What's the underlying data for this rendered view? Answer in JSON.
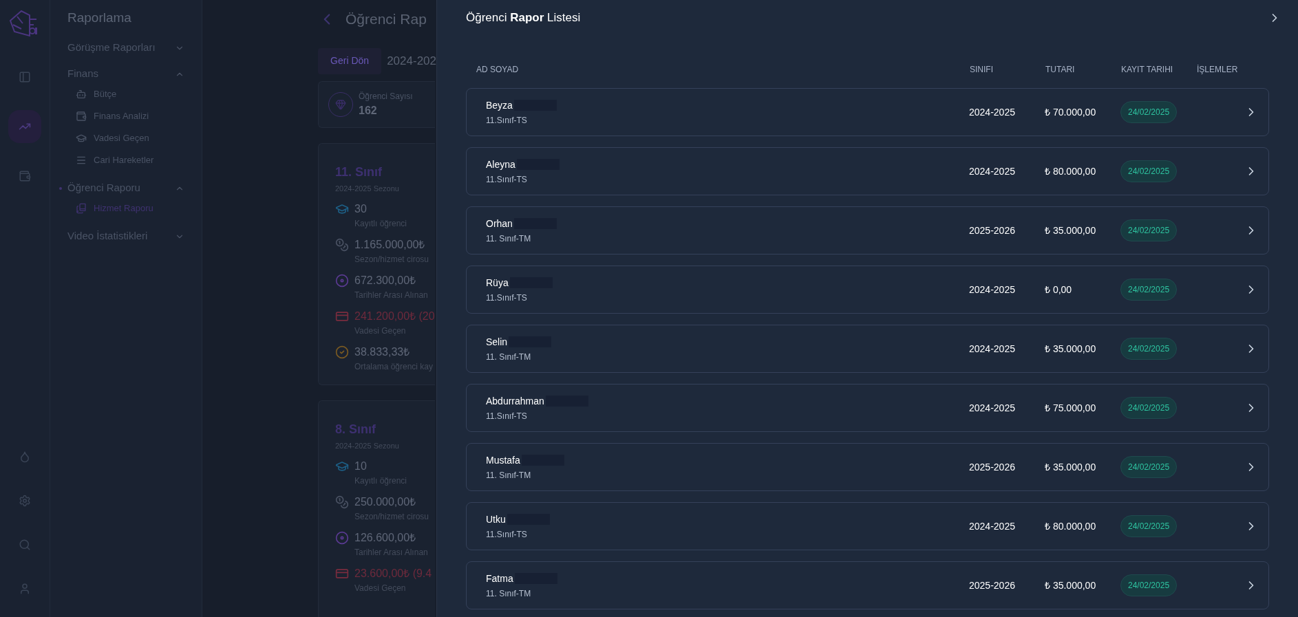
{
  "rail": {
    "items": [
      {
        "kind": "panel",
        "selected": false
      },
      {
        "kind": "chart",
        "selected": true
      },
      {
        "kind": "wallet",
        "selected": false
      }
    ],
    "bottom": [
      {
        "kind": "drop"
      },
      {
        "kind": "settings"
      },
      {
        "kind": "search"
      },
      {
        "kind": "user"
      }
    ]
  },
  "sidebar": {
    "title": "Raporlama",
    "groups": [
      {
        "label": "Görüşme Raporları",
        "expanded": false,
        "active": false
      },
      {
        "label": "Finans",
        "expanded": true,
        "active": false,
        "children": [
          {
            "label": "Bütçe",
            "kind": "bot",
            "selected": false
          },
          {
            "label": "Finans Analizi",
            "kind": "wallet",
            "selected": false
          },
          {
            "label": "Vadesi Geçen",
            "kind": "cap",
            "selected": false
          },
          {
            "label": "Cari Hareketler",
            "kind": "lines",
            "selected": false
          }
        ]
      },
      {
        "label": "Öğrenci Raporu",
        "expanded": true,
        "active": true,
        "children": [
          {
            "label": "Hizmet Raporu",
            "kind": "books",
            "selected": true
          }
        ]
      },
      {
        "label": "Video İstatistikleri",
        "expanded": false,
        "active": false
      }
    ]
  },
  "main": {
    "title": "Öğrenci Rap",
    "back_button": "Geri Dön",
    "season": "2024-202",
    "student_count": {
      "label": "Öğrenci Sayısı",
      "value": "162"
    },
    "classes": [
      {
        "title": "11. Sınıf",
        "season": "2024-2025 Sezonu",
        "stats": [
          {
            "kind": "students",
            "value": "30",
            "label": "Kayıtlı öğrenci"
          },
          {
            "kind": "revenue",
            "value": "1.165.000,00₺",
            "label": "Sezon/hizmet cirosu"
          },
          {
            "kind": "received",
            "value": "672.300,00₺",
            "label": "Tarihler Arası Alınan"
          },
          {
            "kind": "overdue",
            "value": "241.200,00₺ (20",
            "label": "Vadesi Geçen"
          },
          {
            "kind": "average",
            "value": "38.833,33₺",
            "label": "Ortalama öğrenci kay"
          }
        ]
      },
      {
        "title": "8. Sınıf",
        "season": "2024-2025 Sezonu",
        "stats": [
          {
            "kind": "students",
            "value": "10",
            "label": "Kayıtlı öğrenci"
          },
          {
            "kind": "revenue",
            "value": "250.000,00₺",
            "label": "Sezon/hizmet cirosu"
          },
          {
            "kind": "received",
            "value": "126.600,00₺",
            "label": "Tarihler Arası Alınan"
          },
          {
            "kind": "overdue",
            "value": "23.600,00₺ (9.4",
            "label": "Vadesi Geçen"
          }
        ]
      }
    ]
  },
  "panel": {
    "title": "Öğrenci **Rapor** Listesi",
    "columns": [
      "AD SOYAD",
      "SINIFI",
      "TUTARI",
      "KAYIT TARIHI",
      "İŞLEMLER"
    ],
    "rows": [
      {
        "name": "Beyza",
        "group": "11.Sınıf-TS",
        "season": "2024-2025",
        "amount": "₺ 70.000,00",
        "date": "24/02/2025"
      },
      {
        "name": "Aleyna",
        "group": "11.Sınıf-TS",
        "season": "2024-2025",
        "amount": "₺ 80.000,00",
        "date": "24/02/2025"
      },
      {
        "name": "Orhan",
        "group": "11. Sınıf-TM",
        "season": "2025-2026",
        "amount": "₺ 35.000,00",
        "date": "24/02/2025"
      },
      {
        "name": "Rüya",
        "group": "11.Sınıf-TS",
        "season": "2024-2025",
        "amount": "₺ 0,00",
        "date": "24/02/2025"
      },
      {
        "name": "Selin",
        "group": "11. Sınıf-TM",
        "season": "2024-2025",
        "amount": "₺ 35.000,00",
        "date": "24/02/2025"
      },
      {
        "name": "Abdurrahman",
        "group": "11.Sınıf-TS",
        "season": "2024-2025",
        "amount": "₺ 75.000,00",
        "date": "24/02/2025"
      },
      {
        "name": "Mustafa",
        "group": "11. Sınıf-TM",
        "season": "2025-2026",
        "amount": "₺ 35.000,00",
        "date": "24/02/2025"
      },
      {
        "name": "Utku",
        "group": "11.Sınıf-TS",
        "season": "2024-2025",
        "amount": "₺ 80.000,00",
        "date": "24/02/2025"
      },
      {
        "name": "Fatma",
        "group": "11. Sınıf-TM",
        "season": "2025-2026",
        "amount": "₺ 35.000,00",
        "date": "24/02/2025"
      }
    ]
  }
}
